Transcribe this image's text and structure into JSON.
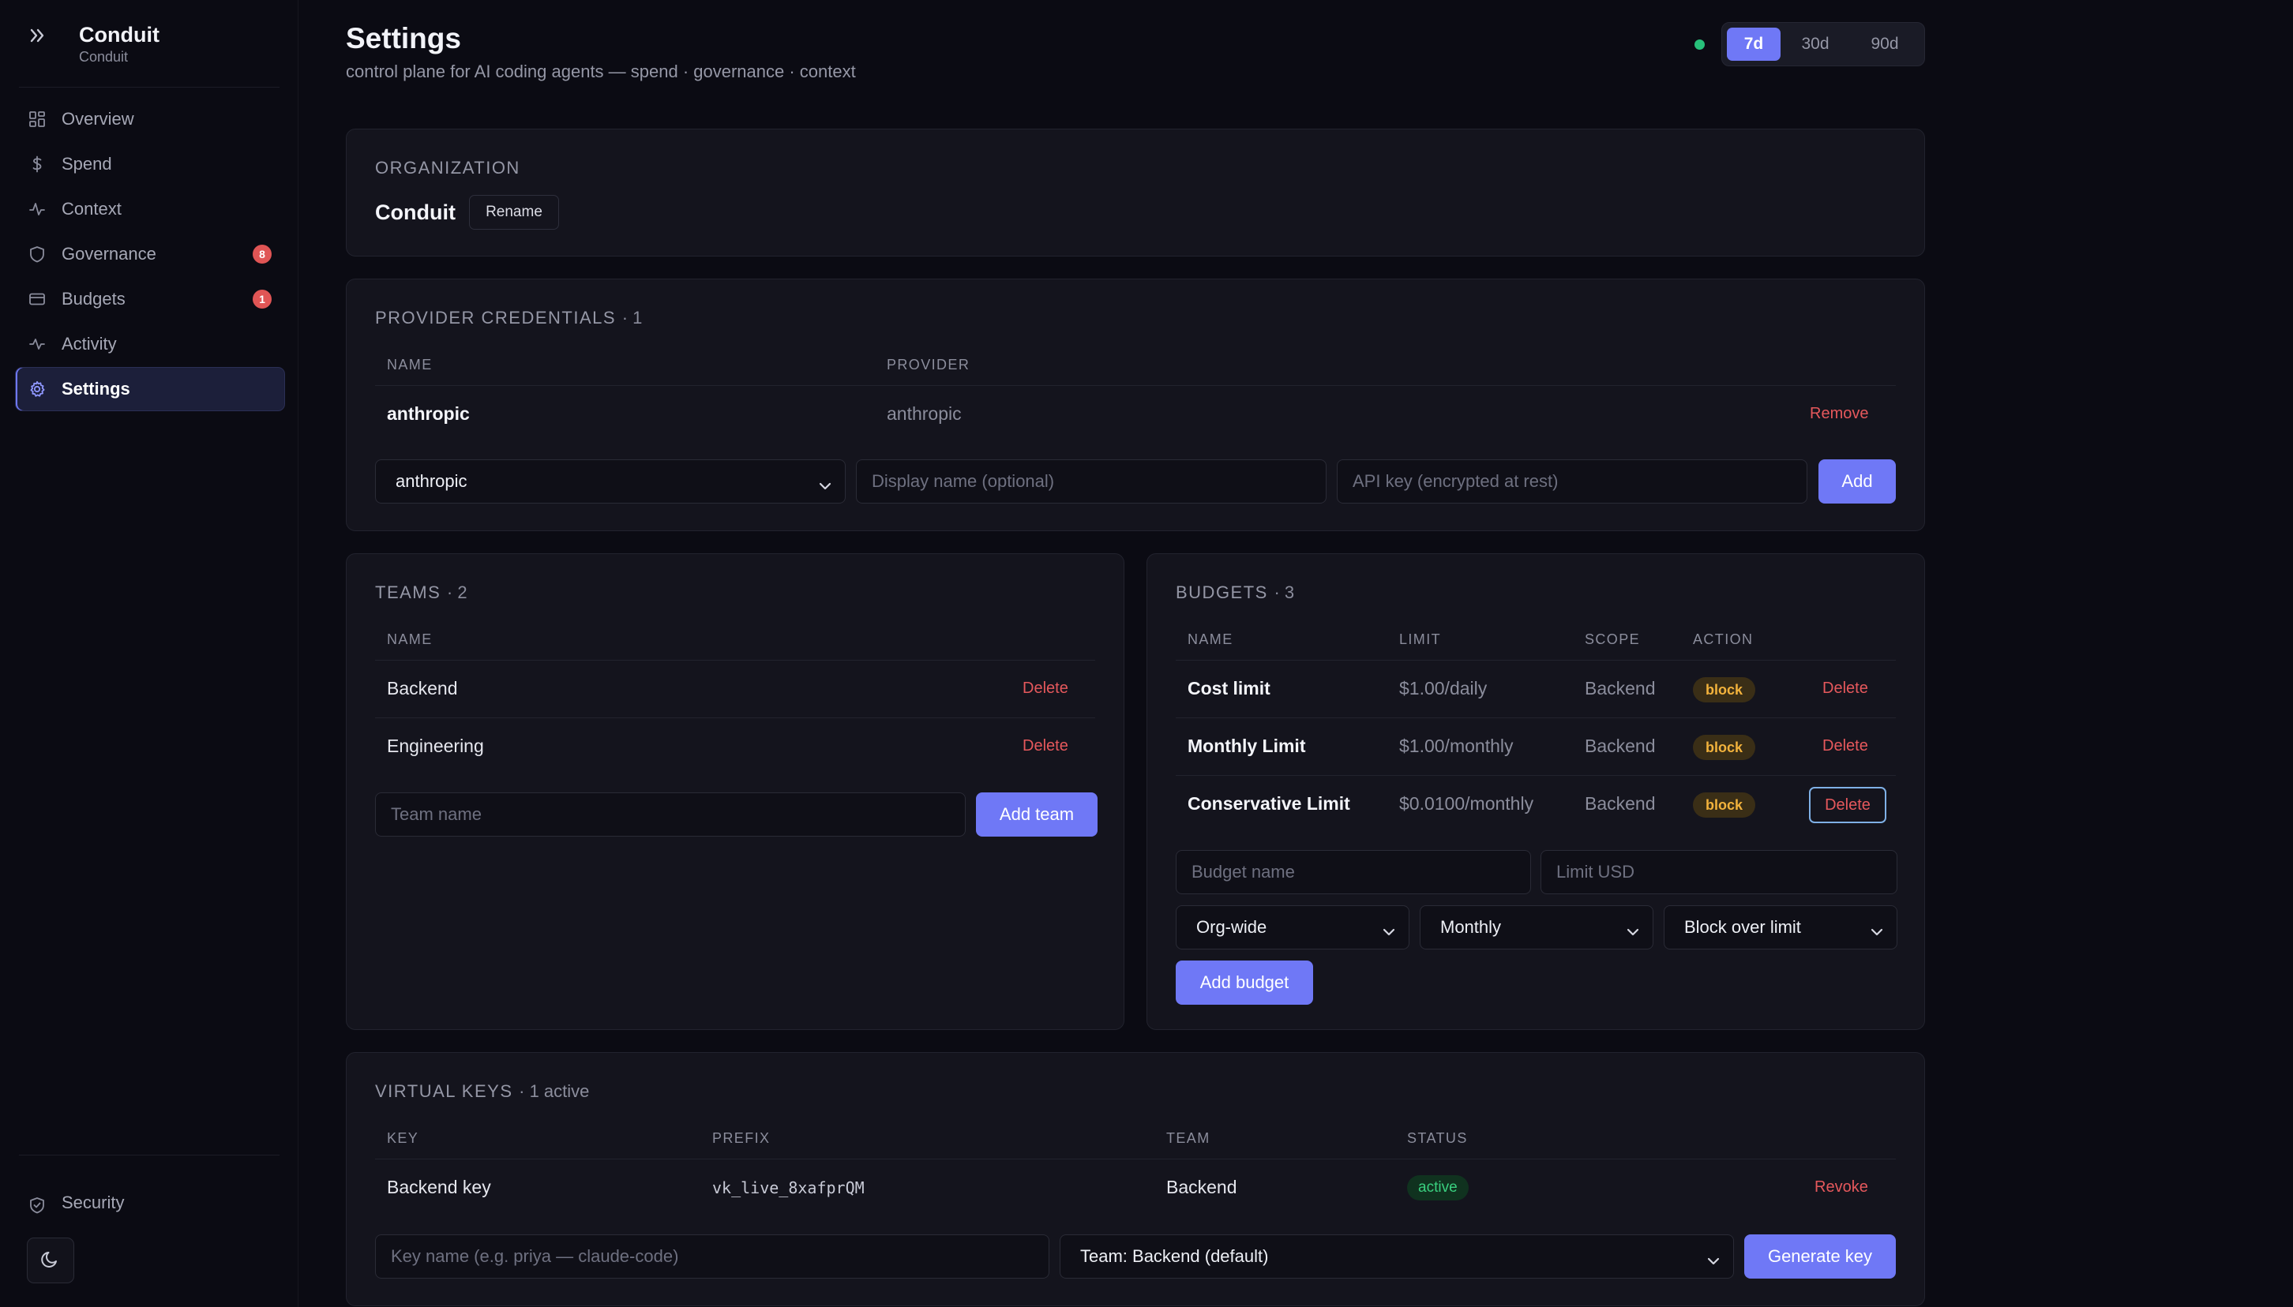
{
  "app": {
    "title": "Conduit",
    "subtitle": "Conduit"
  },
  "sidebar": {
    "items": [
      {
        "label": "Overview",
        "icon": "grid-icon"
      },
      {
        "label": "Spend",
        "icon": "dollar-icon"
      },
      {
        "label": "Context",
        "icon": "pulse-icon"
      },
      {
        "label": "Governance",
        "icon": "shield-icon",
        "badge": "8"
      },
      {
        "label": "Budgets",
        "icon": "card-icon",
        "badge": "1"
      },
      {
        "label": "Activity",
        "icon": "activity-icon"
      },
      {
        "label": "Settings",
        "icon": "gear-icon",
        "active": true
      }
    ],
    "security_label": "Security"
  },
  "header": {
    "title": "Settings",
    "subtitle": "control plane for AI coding agents — spend · governance · context",
    "ranges": [
      "7d",
      "30d",
      "90d"
    ],
    "selected_range": "7d"
  },
  "organization": {
    "heading": "ORGANIZATION",
    "name": "Conduit",
    "rename_label": "Rename"
  },
  "credentials": {
    "heading": "PROVIDER CREDENTIALS",
    "count": "· 1",
    "columns": [
      "NAME",
      "PROVIDER"
    ],
    "rows": [
      {
        "name": "anthropic",
        "provider": "anthropic",
        "action": "Remove"
      }
    ],
    "provider_select": "anthropic",
    "display_name_placeholder": "Display name (optional)",
    "api_key_placeholder": "API key (encrypted at rest)",
    "add_label": "Add"
  },
  "teams": {
    "heading": "TEAMS",
    "count": "· 2",
    "columns": [
      "NAME"
    ],
    "rows": [
      {
        "name": "Backend",
        "action": "Delete"
      },
      {
        "name": "Engineering",
        "action": "Delete"
      }
    ],
    "team_name_placeholder": "Team name",
    "add_label": "Add team"
  },
  "budgets": {
    "heading": "BUDGETS",
    "count": "· 3",
    "columns": [
      "NAME",
      "LIMIT",
      "SCOPE",
      "ACTION"
    ],
    "rows": [
      {
        "name": "Cost limit",
        "limit": "$1.00/daily",
        "scope": "Backend",
        "action": "block",
        "delete": "Delete"
      },
      {
        "name": "Monthly Limit",
        "limit": "$1.00/monthly",
        "scope": "Backend",
        "action": "block",
        "delete": "Delete"
      },
      {
        "name": "Conservative Limit",
        "limit": "$0.0100/monthly",
        "scope": "Backend",
        "action": "block",
        "delete": "Delete"
      }
    ],
    "budget_name_placeholder": "Budget name",
    "limit_placeholder": "Limit USD",
    "scope_select": "Org-wide",
    "period_select": "Monthly",
    "action_select": "Block over limit",
    "add_label": "Add budget"
  },
  "virtual_keys": {
    "heading": "VIRTUAL KEYS",
    "count": "· 1 active",
    "columns": [
      "KEY",
      "PREFIX",
      "TEAM",
      "STATUS"
    ],
    "rows": [
      {
        "key": "Backend key",
        "prefix": "vk_live_8xafprQM",
        "team": "Backend",
        "status": "active",
        "action": "Revoke"
      }
    ],
    "key_name_placeholder": "Key name (e.g. priya — claude-code)",
    "team_select": "Team: Backend (default)",
    "generate_label": "Generate key"
  },
  "colors": {
    "accent": "#6f78f6",
    "danger": "#e5585c",
    "success": "#39d07f",
    "warning": "#f2b23c"
  }
}
